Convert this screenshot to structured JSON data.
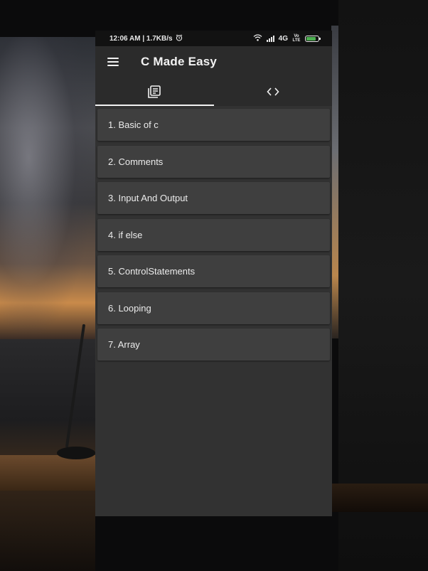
{
  "status_bar": {
    "time_speed": "12:06 AM | 1.7KB/s",
    "network": "4G",
    "volte": "Vo LTE"
  },
  "app_bar": {
    "title": "C Made Easy",
    "menu_icon": "hamburger-menu-icon"
  },
  "tabs": [
    {
      "icon": "article-list-icon",
      "active": true
    },
    {
      "icon": "code-brackets-icon",
      "active": false
    }
  ],
  "topics": [
    "1. Basic of c",
    "2. Comments",
    "3. Input And Output",
    "4. if else",
    "5. ControlStatements",
    "6. Looping",
    "7. Array"
  ],
  "colors": {
    "background": "#323232",
    "app_bar": "#2b2b2b",
    "list_item": "#3f3f3f",
    "battery": "#4caf50"
  }
}
